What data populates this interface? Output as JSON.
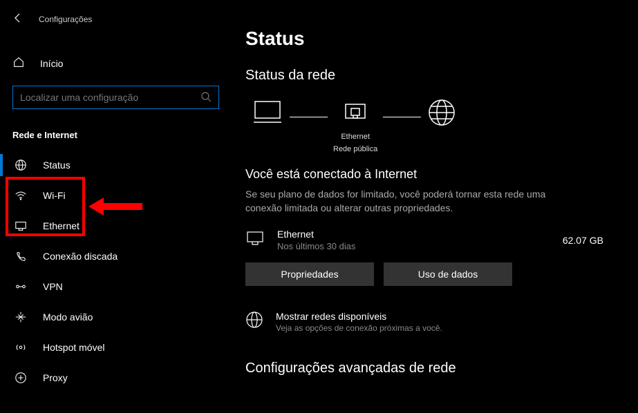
{
  "header": {
    "app_title": "Configurações"
  },
  "sidebar": {
    "home_label": "Início",
    "search_placeholder": "Localizar uma configuração",
    "category_label": "Rede e Internet",
    "items": [
      {
        "label": "Status"
      },
      {
        "label": "Wi-Fi"
      },
      {
        "label": "Ethernet"
      },
      {
        "label": "Conexão discada"
      },
      {
        "label": "VPN"
      },
      {
        "label": "Modo avião"
      },
      {
        "label": "Hotspot móvel"
      },
      {
        "label": "Proxy"
      }
    ]
  },
  "main": {
    "page_title": "Status",
    "section_title": "Status da rede",
    "diagram": {
      "mid_caption_line1": "Ethernet",
      "mid_caption_line2": "Rede pública"
    },
    "connected_title": "Você está conectado à Internet",
    "connected_desc": "Se seu plano de dados for limitado, você poderá tornar esta rede uma conexão limitada ou alterar outras propriedades.",
    "usage": {
      "name": "Ethernet",
      "subtitle": "Nos últimos 30 dias",
      "amount": "62.07 GB"
    },
    "buttons": {
      "properties": "Propriedades",
      "data_usage": "Uso de dados"
    },
    "show_networks": {
      "title": "Mostrar redes disponíveis",
      "subtitle": "Veja as opções de conexão próximas a você."
    },
    "advanced_title": "Configurações avançadas de rede"
  }
}
